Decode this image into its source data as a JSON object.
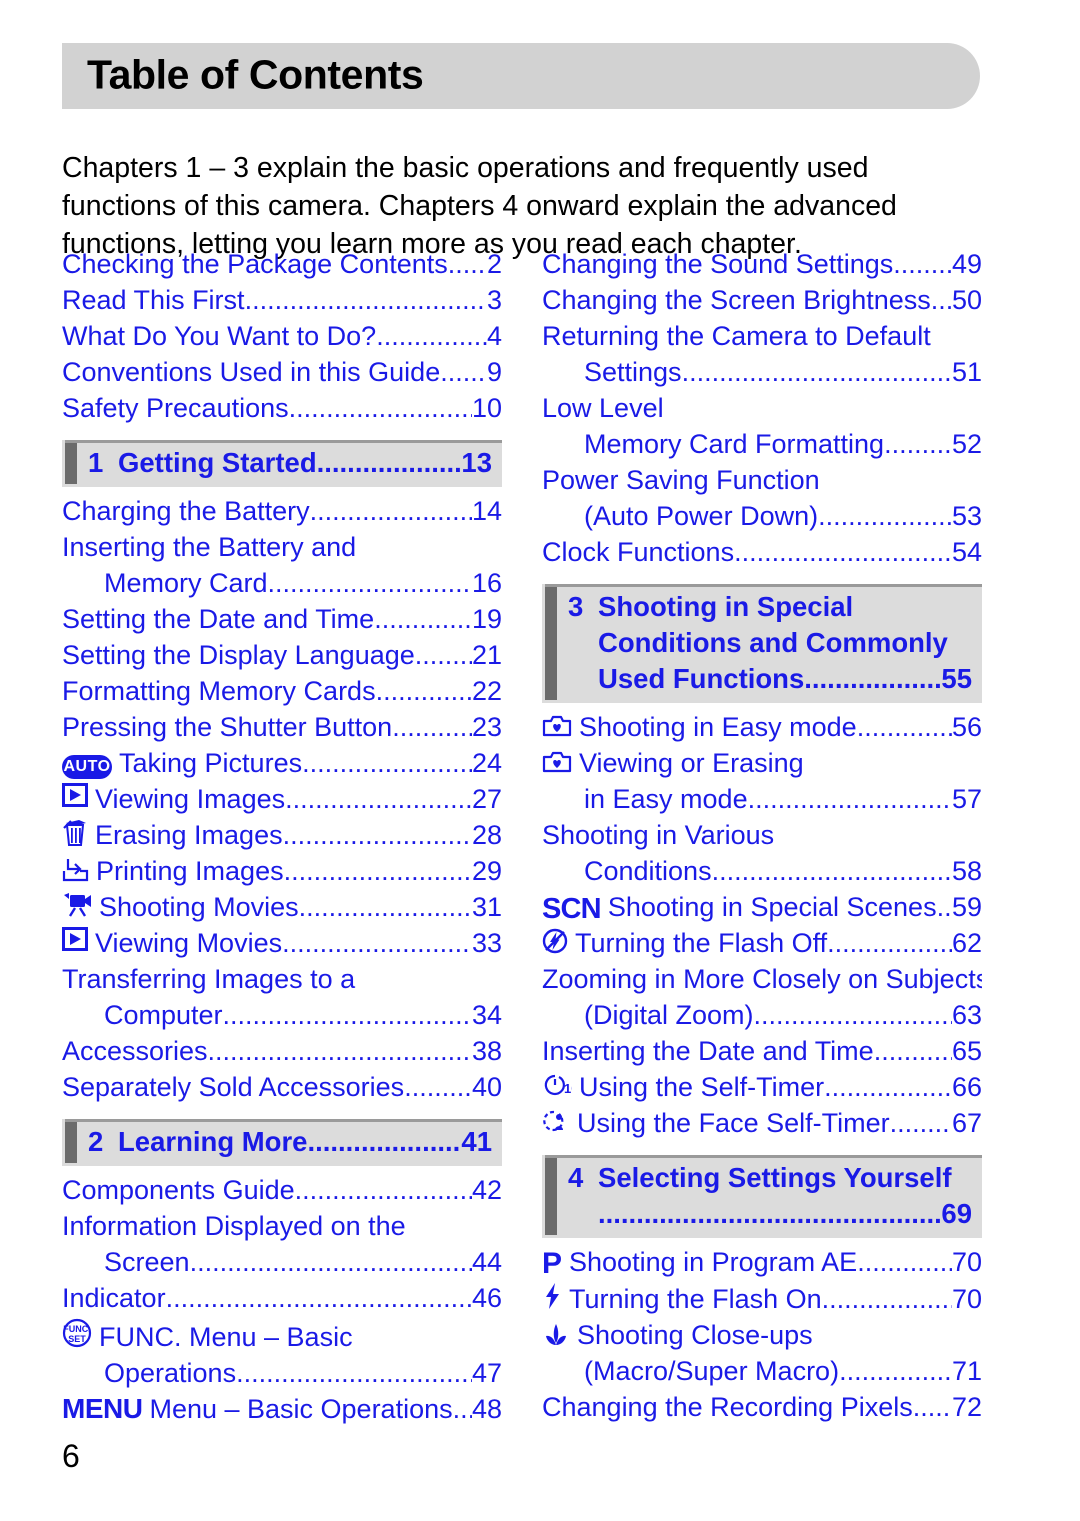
{
  "header": {
    "title": "Table of Contents",
    "bar_color": "#d2d2d2"
  },
  "intro": "Chapters 1 – 3 explain the basic operations and frequently used functions of this camera. Chapters 4 onward explain the advanced functions, letting you learn more as you read each chapter.",
  "colors": {
    "link_blue": "#1a1ae6",
    "chapter_bar_bg": "#dcdcdc",
    "chapter_accent": "#6b6b6b",
    "text_black": "#000000"
  },
  "page_number": "6",
  "left_column": {
    "front_matter": [
      {
        "label": "Checking the Package Contents",
        "page": "2",
        "icon": null,
        "indent": false
      },
      {
        "label": "Read This First",
        "page": "3",
        "icon": null,
        "indent": false
      },
      {
        "label": "What Do You Want to Do?",
        "page": "4",
        "icon": null,
        "indent": false
      },
      {
        "label": "Conventions Used in this Guide",
        "page": "9",
        "icon": null,
        "indent": false
      },
      {
        "label": "Safety Precautions",
        "page": "10",
        "icon": null,
        "indent": false
      }
    ],
    "chapter1": {
      "number": "1",
      "title": "Getting Started",
      "page": "13",
      "entries": [
        {
          "label": "Charging the Battery",
          "page": "14",
          "icon": null,
          "indent": false
        },
        {
          "label": "Inserting the Battery and",
          "page": null,
          "icon": null,
          "indent": false
        },
        {
          "label": "Memory Card",
          "page": "16",
          "icon": null,
          "indent": true
        },
        {
          "label": "Setting the Date and Time",
          "page": "19",
          "icon": null,
          "indent": false
        },
        {
          "label": "Setting the Display Language",
          "page": "21",
          "icon": null,
          "indent": false
        },
        {
          "label": "Formatting Memory Cards",
          "page": "22",
          "icon": null,
          "indent": false
        },
        {
          "label": "Pressing the Shutter Button",
          "page": "23",
          "icon": null,
          "indent": false
        },
        {
          "label": "Taking Pictures",
          "page": "24",
          "icon": "auto-mode-icon",
          "indent": false
        },
        {
          "label": "Viewing Images",
          "page": "27",
          "icon": "playback-icon",
          "indent": false
        },
        {
          "label": "Erasing Images",
          "page": "28",
          "icon": "trash-icon",
          "indent": false
        },
        {
          "label": "Printing Images",
          "page": "29",
          "icon": "print-icon",
          "indent": false
        },
        {
          "label": "Shooting Movies",
          "page": "31",
          "icon": "movie-camera-icon",
          "indent": false
        },
        {
          "label": "Viewing Movies",
          "page": "33",
          "icon": "playback-icon",
          "indent": false
        },
        {
          "label": "Transferring Images to a",
          "page": null,
          "icon": null,
          "indent": false
        },
        {
          "label": "Computer",
          "page": "34",
          "icon": null,
          "indent": true
        },
        {
          "label": "Accessories",
          "page": "38",
          "icon": null,
          "indent": false
        },
        {
          "label": "Separately Sold Accessories",
          "page": "40",
          "icon": null,
          "indent": false
        }
      ]
    },
    "chapter2": {
      "number": "2",
      "title": "Learning More",
      "page": "41",
      "entries": [
        {
          "label": "Components Guide",
          "page": "42",
          "icon": null,
          "indent": false
        },
        {
          "label": "Information Displayed on the",
          "page": null,
          "icon": null,
          "indent": false
        },
        {
          "label": "Screen",
          "page": "44",
          "icon": null,
          "indent": true
        },
        {
          "label": "Indicator",
          "page": "46",
          "icon": null,
          "indent": false
        },
        {
          "label": "FUNC. Menu – Basic",
          "page": null,
          "icon": "func-set-icon",
          "indent": false
        },
        {
          "label": "Operations",
          "page": "47",
          "icon": null,
          "indent": true
        },
        {
          "label": "Menu – Basic Operations",
          "page": "48",
          "icon": "menu-icon",
          "indent": false
        }
      ]
    }
  },
  "right_column": {
    "continued": [
      {
        "label": "Changing the Sound Settings",
        "page": "49",
        "icon": null,
        "indent": false
      },
      {
        "label": "Changing the Screen Brightness",
        "page": "50",
        "icon": null,
        "indent": false
      },
      {
        "label": "Returning the Camera to Default",
        "page": null,
        "icon": null,
        "indent": false
      },
      {
        "label": "Settings",
        "page": "51",
        "icon": null,
        "indent": true
      },
      {
        "label": "Low Level",
        "page": null,
        "icon": null,
        "indent": false
      },
      {
        "label": "Memory Card Formatting",
        "page": "52",
        "icon": null,
        "indent": true
      },
      {
        "label": "Power Saving Function",
        "page": null,
        "icon": null,
        "indent": false
      },
      {
        "label": "(Auto Power Down)",
        "page": "53",
        "icon": null,
        "indent": true
      },
      {
        "label": "Clock Functions",
        "page": "54",
        "icon": null,
        "indent": false
      }
    ],
    "chapter3": {
      "number": "3",
      "title_lines": [
        "Shooting in Special",
        "Conditions and Commonly",
        "Used Functions"
      ],
      "page": "55",
      "entries": [
        {
          "label": "Shooting in Easy mode",
          "page": "56",
          "icon": "easy-mode-icon",
          "indent": false
        },
        {
          "label": "Viewing or Erasing",
          "page": null,
          "icon": "easy-mode-icon",
          "indent": false
        },
        {
          "label": "in Easy mode",
          "page": "57",
          "icon": null,
          "indent": true
        },
        {
          "label": "Shooting in Various",
          "page": null,
          "icon": null,
          "indent": false
        },
        {
          "label": "Conditions",
          "page": "58",
          "icon": null,
          "indent": true
        },
        {
          "label": "Shooting in Special Scenes",
          "page": "59",
          "icon": "scn-icon",
          "indent": false
        },
        {
          "label": "Turning the Flash Off",
          "page": "62",
          "icon": "flash-off-icon",
          "indent": false
        },
        {
          "label": "Zooming in More Closely on Subjects",
          "page": null,
          "icon": null,
          "indent": false
        },
        {
          "label": "(Digital Zoom)",
          "page": "63",
          "icon": null,
          "indent": true
        },
        {
          "label": "Inserting the Date and Time",
          "page": "65",
          "icon": null,
          "indent": false
        },
        {
          "label": "Using the Self-Timer",
          "page": "66",
          "icon": "self-timer-icon",
          "indent": false
        },
        {
          "label": "Using the Face Self-Timer",
          "page": "67",
          "icon": "face-self-timer-icon",
          "indent": false
        }
      ]
    },
    "chapter4": {
      "number": "4",
      "title": "Selecting Settings Yourself",
      "page": "69",
      "entries": [
        {
          "label": "Shooting in Program AE",
          "page": "70",
          "icon": "program-ae-icon",
          "indent": false
        },
        {
          "label": "Turning the Flash On",
          "page": "70",
          "icon": "flash-on-icon",
          "indent": false
        },
        {
          "label": "Shooting Close-ups",
          "page": null,
          "icon": "macro-icon",
          "indent": false
        },
        {
          "label": "(Macro/Super Macro)",
          "page": "71",
          "icon": null,
          "indent": true
        },
        {
          "label": "Changing the Recording Pixels",
          "page": "72",
          "icon": null,
          "indent": false
        }
      ]
    }
  },
  "icon_glyphs": {
    "auto-mode-icon": "AUTO",
    "menu-icon": "MENU",
    "scn-icon": "SCN",
    "program-ae-icon": "P",
    "func-set-icon": "FUNC. SET"
  }
}
